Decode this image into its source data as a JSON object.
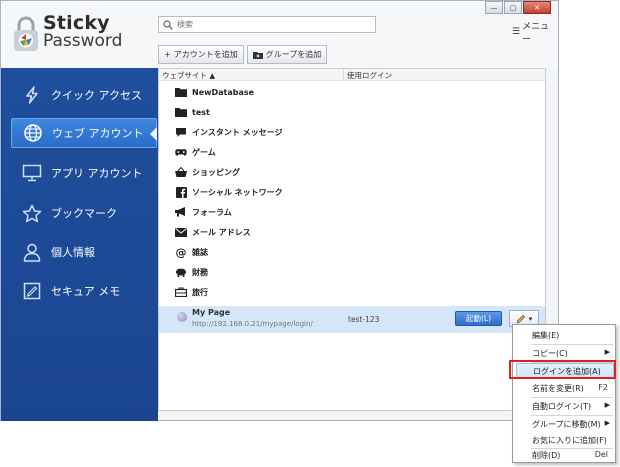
{
  "app": {
    "logo_line1": "Sticky",
    "logo_line2": "Password"
  },
  "window_buttons": {
    "minimize": "—",
    "maximize": "▢",
    "close": "✕"
  },
  "search": {
    "placeholder": "検索"
  },
  "menu": {
    "label": "メニュー"
  },
  "toolbar": {
    "add_account": "アカウントを追加",
    "add_group": "グループを追加"
  },
  "sidebar": {
    "items": [
      {
        "label": "クイック アクセス",
        "icon": "lightning-icon"
      },
      {
        "label": "ウェブ アカウント",
        "icon": "globe-icon",
        "active": true
      },
      {
        "label": "アプリ アカウント",
        "icon": "monitor-icon"
      },
      {
        "label": "ブックマーク",
        "icon": "star-icon"
      },
      {
        "label": "個人情報",
        "icon": "person-icon"
      },
      {
        "label": "セキュア メモ",
        "icon": "note-icon"
      }
    ]
  },
  "table": {
    "col_website": "ウェブサイト",
    "col_login": "使用ログイン",
    "groups": [
      {
        "label": "NewDatabase",
        "icon": "folder-icon"
      },
      {
        "label": "test",
        "icon": "folder-icon"
      },
      {
        "label": "インスタント メッセージ",
        "icon": "chat-icon"
      },
      {
        "label": "ゲーム",
        "icon": "gamepad-icon"
      },
      {
        "label": "ショッピング",
        "icon": "basket-icon"
      },
      {
        "label": "ソーシャル ネットワーク",
        "icon": "facebook-icon"
      },
      {
        "label": "フォーラム",
        "icon": "megaphone-icon"
      },
      {
        "label": "メール アドレス",
        "icon": "envelope-icon"
      },
      {
        "label": "雑誌",
        "icon": "at-icon"
      },
      {
        "label": "財務",
        "icon": "piggybank-icon"
      },
      {
        "label": "旅行",
        "icon": "suitcase-icon"
      }
    ],
    "selected": {
      "name": "My Page",
      "url": "http://192.168.0.21/mypage/login/",
      "login": "test-123",
      "launch": "起動(L)"
    }
  },
  "context_menu": {
    "items": [
      {
        "label": "編集(E)",
        "shortcut": ""
      },
      {
        "label": "コピー(C)",
        "shortcut": "",
        "submenu": true
      },
      {
        "label": "ログインを追加(A)",
        "shortcut": "",
        "highlighted": true
      },
      {
        "label": "名前を変更(R)",
        "shortcut": "F2"
      },
      {
        "label": "自動ログイン(T)",
        "shortcut": "",
        "submenu": true
      },
      {
        "label": "グループに移動(M)",
        "shortcut": "",
        "submenu": true
      },
      {
        "label": "お気に入りに追加(F)",
        "shortcut": ""
      },
      {
        "label": "削除(D)",
        "shortcut": "Del"
      }
    ]
  },
  "colors": {
    "sidebar_bg": "#1f4f9c",
    "active_item": "#3f86de",
    "launch_btn": "#2f6cc6",
    "highlight_border": "#e0201a"
  }
}
